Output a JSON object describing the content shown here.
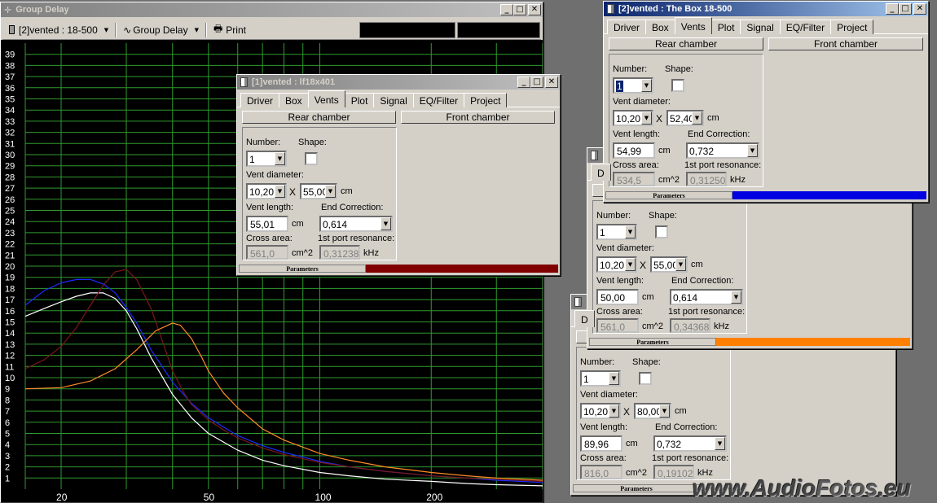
{
  "group_delay": {
    "title": "Group Delay",
    "toolbar": {
      "driver_select": "[2]vented : 18-500",
      "plot_select": "Group Delay",
      "print_label": "Print"
    },
    "icons": {
      "driver": "speaker-icon",
      "plot": "wave-icon",
      "print": "printer-icon"
    }
  },
  "chart_data": {
    "type": "line",
    "x_scale": "log",
    "xlim": [
      16,
      400
    ],
    "ylim": [
      0,
      40
    ],
    "y_ticks": [
      1,
      2,
      3,
      4,
      5,
      6,
      7,
      8,
      9,
      10,
      11,
      12,
      13,
      14,
      15,
      16,
      17,
      18,
      19,
      20,
      21,
      22,
      23,
      24,
      25,
      26,
      27,
      28,
      29,
      30,
      31,
      32,
      33,
      34,
      35,
      36,
      37,
      38,
      39
    ],
    "x_tick_labels": [
      "20",
      "50",
      "100",
      "200"
    ],
    "x_tick_values": [
      20,
      50,
      100,
      200
    ],
    "grid": true,
    "series": [
      {
        "color": "#1c2cff",
        "x": [
          16,
          18,
          20,
          22,
          24,
          26,
          28,
          30,
          32,
          35,
          40,
          45,
          50,
          60,
          70,
          80,
          100,
          120,
          150,
          200,
          250,
          300,
          400
        ],
        "y": [
          16.5,
          17.8,
          18.5,
          18.8,
          18.8,
          18.4,
          17.6,
          16.3,
          14.9,
          12.5,
          9.6,
          7.7,
          6.4,
          4.8,
          3.9,
          3.3,
          2.5,
          2.0,
          1.6,
          1.2,
          1.0,
          0.8,
          0.6
        ]
      },
      {
        "color": "#ffffff",
        "x": [
          16,
          18,
          20,
          22,
          24,
          26,
          28,
          30,
          32,
          35,
          40,
          45,
          50,
          60,
          70,
          80,
          100,
          120,
          150,
          200,
          250,
          300,
          400
        ],
        "y": [
          15.5,
          16.2,
          16.8,
          17.3,
          17.6,
          17.6,
          17.1,
          16.0,
          14.4,
          11.8,
          8.5,
          6.4,
          5.0,
          3.5,
          2.6,
          2.1,
          1.5,
          1.2,
          0.9,
          0.7,
          0.5,
          0.4,
          0.3
        ]
      },
      {
        "color": "#7a1818",
        "x": [
          16,
          18,
          20,
          22,
          24,
          26,
          28,
          30,
          32,
          35,
          38,
          40,
          43,
          45,
          50,
          55,
          60,
          70,
          80,
          100,
          120,
          150,
          200,
          250,
          300,
          400
        ],
        "y": [
          10.8,
          11.6,
          12.8,
          14.5,
          16.5,
          18.3,
          19.5,
          19.7,
          18.8,
          16.2,
          12.8,
          10.6,
          8.6,
          7.6,
          6.2,
          5.3,
          4.6,
          3.7,
          3.1,
          2.4,
          2.0,
          1.6,
          1.2,
          1.0,
          0.9,
          0.7
        ]
      },
      {
        "color": "#ff8c28",
        "x": [
          16,
          20,
          24,
          28,
          32,
          36,
          40,
          42,
          45,
          48,
          50,
          55,
          60,
          70,
          80,
          100,
          120,
          150,
          200,
          250,
          300,
          400
        ],
        "y": [
          9.0,
          9.1,
          9.7,
          10.8,
          12.5,
          14.2,
          14.9,
          14.7,
          13.5,
          11.8,
          10.6,
          8.6,
          7.3,
          5.4,
          4.4,
          3.2,
          2.6,
          2.0,
          1.5,
          1.2,
          1.0,
          0.8
        ]
      }
    ]
  },
  "windows": {
    "w1": {
      "title": "[1]vented : lf18x401",
      "tabs": [
        "Driver",
        "Box",
        "Vents",
        "Plot",
        "Signal",
        "EQ/Filter",
        "Project"
      ],
      "rear_chamber": "Rear chamber",
      "front_chamber": "Front chamber",
      "number_label": "Number:",
      "shape_label": "Shape:",
      "number": "1",
      "vent_diameter_label": "Vent diameter:",
      "diam1": "10,20",
      "x_sym": "X",
      "diam2": "55,00",
      "unit_cm": "cm",
      "vent_length_label": "Vent length:",
      "length": "55,01",
      "end_correction_label": "End Correction:",
      "end_correction": "0,614",
      "cross_area_label": "Cross area:",
      "cross_area": "561,0",
      "area_unit": "cm^2",
      "resonance_label": "1st port resonance:",
      "resonance": "0,31238",
      "khz": "kHz",
      "params": "Parameters",
      "status_color": "#800000"
    },
    "w2": {
      "title": "[2]vented : The Box 18-500",
      "tabs": [
        "Driver",
        "Box",
        "Vents",
        "Plot",
        "Signal",
        "EQ/Filter",
        "Project"
      ],
      "rear_chamber": "Rear chamber",
      "front_chamber": "Front chamber",
      "number_label": "Number:",
      "shape_label": "Shape:",
      "number": "1",
      "vent_diameter_label": "Vent diameter:",
      "diam1": "10,20",
      "x_sym": "X",
      "diam2": "52,40",
      "unit_cm": "cm",
      "vent_length_label": "Vent length:",
      "length": "54,99",
      "end_correction_label": "End Correction:",
      "end_correction": "0,732",
      "cross_area_label": "Cross area:",
      "cross_area": "534,5",
      "area_unit": "cm^2",
      "resonance_label": "1st port resonance:",
      "resonance": "0,31250",
      "khz": "kHz",
      "params": "Parameters",
      "status_color": "#0000e0"
    },
    "w3": {
      "tab_fragment": "D",
      "number_label": "Number:",
      "shape_label": "Shape:",
      "number": "1",
      "vent_diameter_label": "Vent diameter:",
      "diam1": "10,20",
      "x_sym": "X",
      "diam2": "55,00",
      "unit_cm": "cm",
      "vent_length_label": "Vent length:",
      "length": "50,00",
      "end_correction_label": "End Correction:",
      "end_correction": "0,614",
      "cross_area_label": "Cross area:",
      "cross_area": "561,0",
      "area_unit": "cm^2",
      "resonance_label": "1st port resonance:",
      "resonance": "0,34368",
      "khz": "kHz",
      "params": "Parameters",
      "status_color": "#ff8000"
    },
    "w4": {
      "tab_fragment": "D",
      "number_label": "Number:",
      "shape_label": "Shape:",
      "number": "1",
      "vent_diameter_label": "Vent diameter:",
      "diam1": "10,20",
      "x_sym": "X",
      "diam2": "80,00",
      "unit_cm": "cm",
      "vent_length_label": "Vent length:",
      "length": "89,96",
      "end_correction_label": "End Correction:",
      "end_correction": "0,732",
      "cross_area_label": "Cross area:",
      "cross_area": "816,0",
      "area_unit": "cm^2",
      "resonance_label": "1st port resonance:",
      "resonance": "0,19102",
      "khz": "kHz",
      "params": "Parameters",
      "status_color": "#d4d0c8"
    }
  },
  "watermark": {
    "part1": "www.",
    "part2": "Audio",
    "part3": "Fotos",
    "part4": ".eu"
  }
}
